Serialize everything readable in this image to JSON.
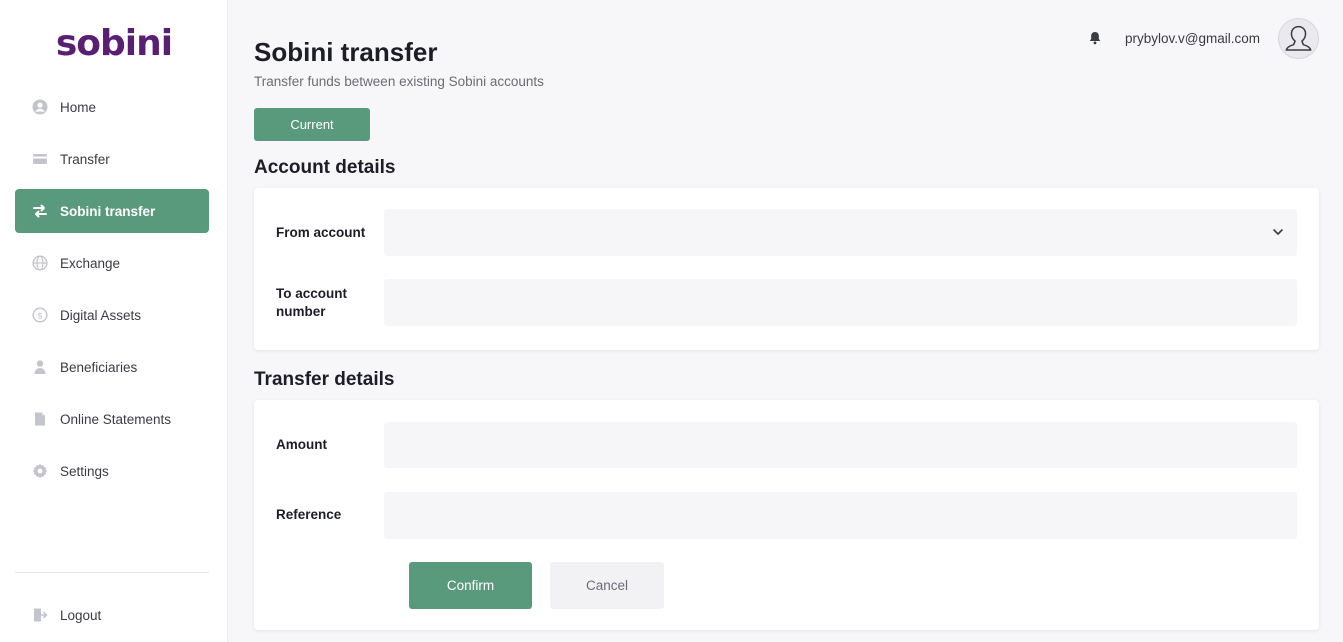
{
  "app": {
    "logo_text": "sobini",
    "brand_color": "#5a1e73",
    "accent_color": "#5a9a7c"
  },
  "sidebar": {
    "items": [
      {
        "label": "Home",
        "icon": "user-circle-icon"
      },
      {
        "label": "Transfer",
        "icon": "card-icon"
      },
      {
        "label": "Sobini transfer",
        "icon": "arrows-exchange-icon",
        "active": true
      },
      {
        "label": "Exchange",
        "icon": "globe-icon"
      },
      {
        "label": "Digital Assets",
        "icon": "coin-icon"
      },
      {
        "label": "Beneficiaries",
        "icon": "person-icon"
      },
      {
        "label": "Online Statements",
        "icon": "document-icon"
      },
      {
        "label": "Settings",
        "icon": "gear-icon"
      }
    ],
    "logout_label": "Logout"
  },
  "header": {
    "title": "Sobini transfer",
    "subtitle": "Transfer funds between existing Sobini accounts",
    "user_email": "prybylov.v@gmail.com"
  },
  "tabs": {
    "current_label": "Current"
  },
  "account_details": {
    "title": "Account details",
    "from_label": "From account",
    "from_value": "",
    "to_label": "To account number",
    "to_value": ""
  },
  "transfer_details": {
    "title": "Transfer details",
    "amount_label": "Amount",
    "amount_value": "",
    "reference_label": "Reference",
    "reference_value": "",
    "confirm_label": "Confirm",
    "cancel_label": "Cancel"
  }
}
